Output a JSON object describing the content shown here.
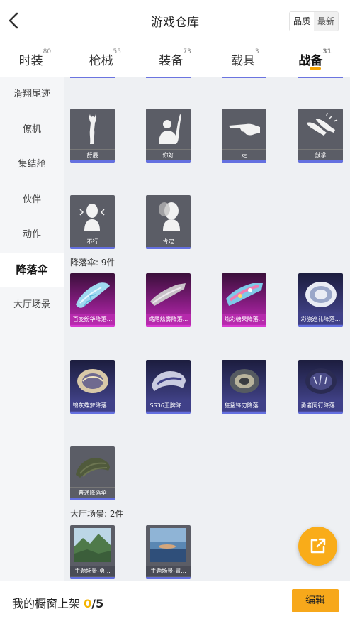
{
  "header": {
    "title": "游戏仓库",
    "sort_quality": "品质",
    "sort_latest": "最新"
  },
  "tabs": [
    {
      "label": "时装",
      "count": "80"
    },
    {
      "label": "枪械",
      "count": "55"
    },
    {
      "label": "装备",
      "count": "73"
    },
    {
      "label": "载具",
      "count": "3"
    },
    {
      "label": "战备",
      "count": "31"
    }
  ],
  "sidebar": [
    {
      "label": "滑翔尾迹"
    },
    {
      "label": "僚机"
    },
    {
      "label": "集结舱"
    },
    {
      "label": "伙伴"
    },
    {
      "label": "动作"
    },
    {
      "label": "降落伞"
    },
    {
      "label": "大厅场景"
    }
  ],
  "emotes": [
    {
      "name": "舒展",
      "icon": "stretch-pose-icon"
    },
    {
      "name": "你好",
      "icon": "waving-hello-icon"
    },
    {
      "name": "走",
      "icon": "pointing-hand-icon"
    },
    {
      "name": "鼓掌",
      "icon": "clapping-hands-icon"
    },
    {
      "name": "不行",
      "icon": "head-shake-icon"
    },
    {
      "name": "肯定",
      "icon": "head-nod-icon"
    }
  ],
  "parachute_section": "降落伞: 9件",
  "parachutes": [
    {
      "name": "百变纷华降落..."
    },
    {
      "name": "鸢尾炫雾降落..."
    },
    {
      "name": "炫彩糖果降落..."
    },
    {
      "name": "彩旗巡礼降落..."
    },
    {
      "name": "锦灰蝶梦降落..."
    },
    {
      "name": "SS36王牌降..."
    },
    {
      "name": "狂鲨锋刃降落..."
    },
    {
      "name": "勇者同行降落..."
    },
    {
      "name": "普通降落伞"
    }
  ],
  "scene_section": "大厅场景: 2件",
  "scenes": [
    {
      "name": "主题场景-勇..."
    },
    {
      "name": "主题场景-冒..."
    }
  ],
  "footer": {
    "label": "我的橱窗上架",
    "current": "0",
    "total": "/5",
    "edit": "编辑"
  },
  "colors": {
    "accent": "#f5a300",
    "edit_button": "#f7a81b",
    "share_button": "#f9ac19",
    "item_bar": "#6470e0",
    "rare_pink": "#b62aac",
    "epic_navy": "#3f4088"
  }
}
